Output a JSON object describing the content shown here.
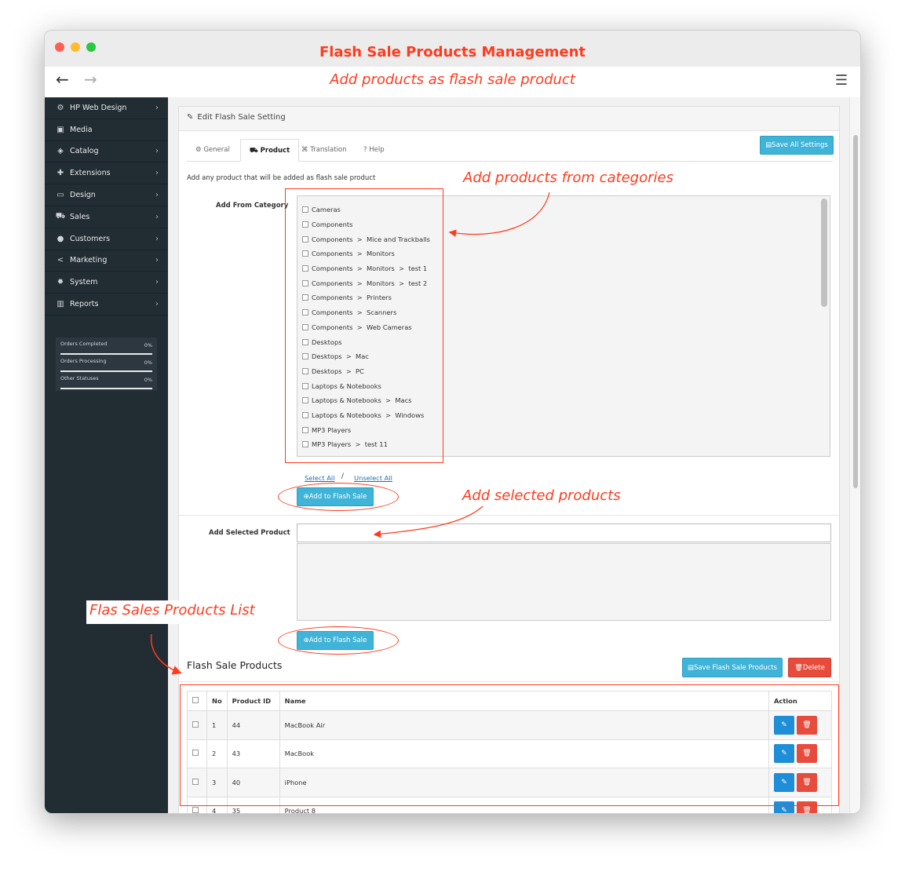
{
  "window": {
    "title": "Flash Sale Products Management",
    "subtitle": "Add products as flash sale product",
    "back_icon": "arrow-left-icon",
    "forward_icon": "arrow-right-icon",
    "menu_icon": "hamburger-icon"
  },
  "sidebar": {
    "items": [
      {
        "label": "HP Web Design",
        "icon": "cogs-icon",
        "glyph": "⚙",
        "chev": "›"
      },
      {
        "label": "Media",
        "icon": "image-icon",
        "glyph": "▣",
        "chev": ""
      },
      {
        "label": "Catalog",
        "icon": "tags-icon",
        "glyph": "◈",
        "chev": "›"
      },
      {
        "label": "Extensions",
        "icon": "puzzle-icon",
        "glyph": "✚",
        "chev": "›"
      },
      {
        "label": "Design",
        "icon": "monitor-icon",
        "glyph": "▭",
        "chev": "›"
      },
      {
        "label": "Sales",
        "icon": "cart-icon",
        "glyph": "⛟",
        "chev": "›"
      },
      {
        "label": "Customers",
        "icon": "user-icon",
        "glyph": "●",
        "chev": "›"
      },
      {
        "label": "Marketing",
        "icon": "share-icon",
        "glyph": "<",
        "chev": "›"
      },
      {
        "label": "System",
        "icon": "gear-icon",
        "glyph": "✹",
        "chev": "›"
      },
      {
        "label": "Reports",
        "icon": "bar-chart-icon",
        "glyph": "▥",
        "chev": "›"
      }
    ],
    "stats": [
      {
        "label": "Orders Completed",
        "value": "0%"
      },
      {
        "label": "Orders Processing",
        "value": "0%"
      },
      {
        "label": "Other Statuses",
        "value": "0%"
      }
    ]
  },
  "panel": {
    "heading": "Edit Flash Sale Setting",
    "heading_icon": "pencil-icon",
    "tabs": [
      {
        "label": "General",
        "icon": "cog-icon"
      },
      {
        "label": "Product",
        "icon": "cart-icon"
      },
      {
        "label": "Translation",
        "icon": "language-icon"
      },
      {
        "label": "Help",
        "icon": "help-icon"
      }
    ],
    "save_all_label": "Save All Settings",
    "description": "Add any product that will be added as flash sale product",
    "add_from_category_label": "Add From Category",
    "categories": [
      "Cameras",
      "Components",
      "Components  >  Mice and Trackballs",
      "Components  >  Monitors",
      "Components  >  Monitors  >  test 1",
      "Components  >  Monitors  >  test 2",
      "Components  >  Printers",
      "Components  >  Scanners",
      "Components  >  Web Cameras",
      "Desktops",
      "Desktops  >  Mac",
      "Desktops  >  PC",
      "Laptops & Notebooks",
      "Laptops & Notebooks  >  Macs",
      "Laptops & Notebooks  >  Windows",
      "MP3 Players",
      "MP3 Players  >  test 11"
    ],
    "select_all": "Select All",
    "slash": "/",
    "unselect_all": "Unselect All",
    "add_to_flash_sale": "Add to Flash Sale",
    "add_selected_label": "Add Selected Product",
    "add_selected_value": "",
    "flash_products_title": "Flash Sale Products",
    "save_flash_label": "Save Flash Sale Products",
    "delete_label": "Delete"
  },
  "table": {
    "headers": [
      "No",
      "Product ID",
      "Name",
      "Action"
    ],
    "rows": [
      {
        "no": "1",
        "id": "44",
        "name": "MacBook Air"
      },
      {
        "no": "2",
        "id": "43",
        "name": "MacBook"
      },
      {
        "no": "3",
        "id": "40",
        "name": "iPhone"
      },
      {
        "no": "4",
        "id": "35",
        "name": "Product 8"
      }
    ]
  },
  "annotations": {
    "categories": "Add products from categories",
    "selected": "Add selected products",
    "list": "Flas Sales Products List",
    "color": "#ff3b1e"
  }
}
